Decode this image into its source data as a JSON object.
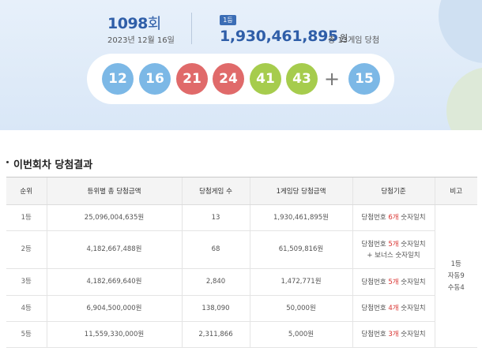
{
  "draw": {
    "round_number": "1098",
    "round_suffix": "회",
    "date": "2023년 12월 16일"
  },
  "first_prize": {
    "badge": "1등",
    "amount": "1,930,461,895",
    "unit": "원",
    "winners_text": "총 13게임 당첨"
  },
  "balls": [
    {
      "number": "12",
      "color": "#7cb8e6"
    },
    {
      "number": "16",
      "color": "#7cb8e6"
    },
    {
      "number": "21",
      "color": "#e06a6a"
    },
    {
      "number": "24",
      "color": "#e06a6a"
    },
    {
      "number": "41",
      "color": "#a6cc4d"
    },
    {
      "number": "43",
      "color": "#a6cc4d"
    }
  ],
  "plus_sign": "+",
  "bonus_ball": {
    "number": "15",
    "color": "#7cb8e6"
  },
  "section": {
    "title": "이번회차 당첨결과"
  },
  "table": {
    "headers": [
      "순위",
      "등위별 총 당첨금액",
      "당첨게임 수",
      "1게임당 당첨금액",
      "당첨기준",
      "비고"
    ],
    "rows": [
      {
        "rank": "1등",
        "total": "25,096,004,635원",
        "games": "13",
        "per_game": "1,930,461,895원",
        "criteria_prefix": "당첨번호 ",
        "criteria_count": "6개",
        "criteria_suffix": " 숫자일치",
        "criteria_extra": ""
      },
      {
        "rank": "2등",
        "total": "4,182,667,488원",
        "games": "68",
        "per_game": "61,509,816원",
        "criteria_prefix": "당첨번호 ",
        "criteria_count": "5개",
        "criteria_suffix": " 숫자일치",
        "criteria_extra": "+ 보너스 숫자일치"
      },
      {
        "rank": "3등",
        "total": "4,182,669,640원",
        "games": "2,840",
        "per_game": "1,472,771원",
        "criteria_prefix": "당첨번호 ",
        "criteria_count": "5개",
        "criteria_suffix": " 숫자일치",
        "criteria_extra": ""
      },
      {
        "rank": "4등",
        "total": "6,904,500,000원",
        "games": "138,090",
        "per_game": "50,000원",
        "criteria_prefix": "당첨번호 ",
        "criteria_count": "4개",
        "criteria_suffix": " 숫자일치",
        "criteria_extra": ""
      },
      {
        "rank": "5등",
        "total": "11,559,330,000원",
        "games": "2,311,866",
        "per_game": "5,000원",
        "criteria_prefix": "당첨번호 ",
        "criteria_count": "3개",
        "criteria_suffix": " 숫자일치",
        "criteria_extra": ""
      }
    ],
    "note": {
      "line1": "1등",
      "line2": "자동9",
      "line3": "수동4"
    }
  }
}
